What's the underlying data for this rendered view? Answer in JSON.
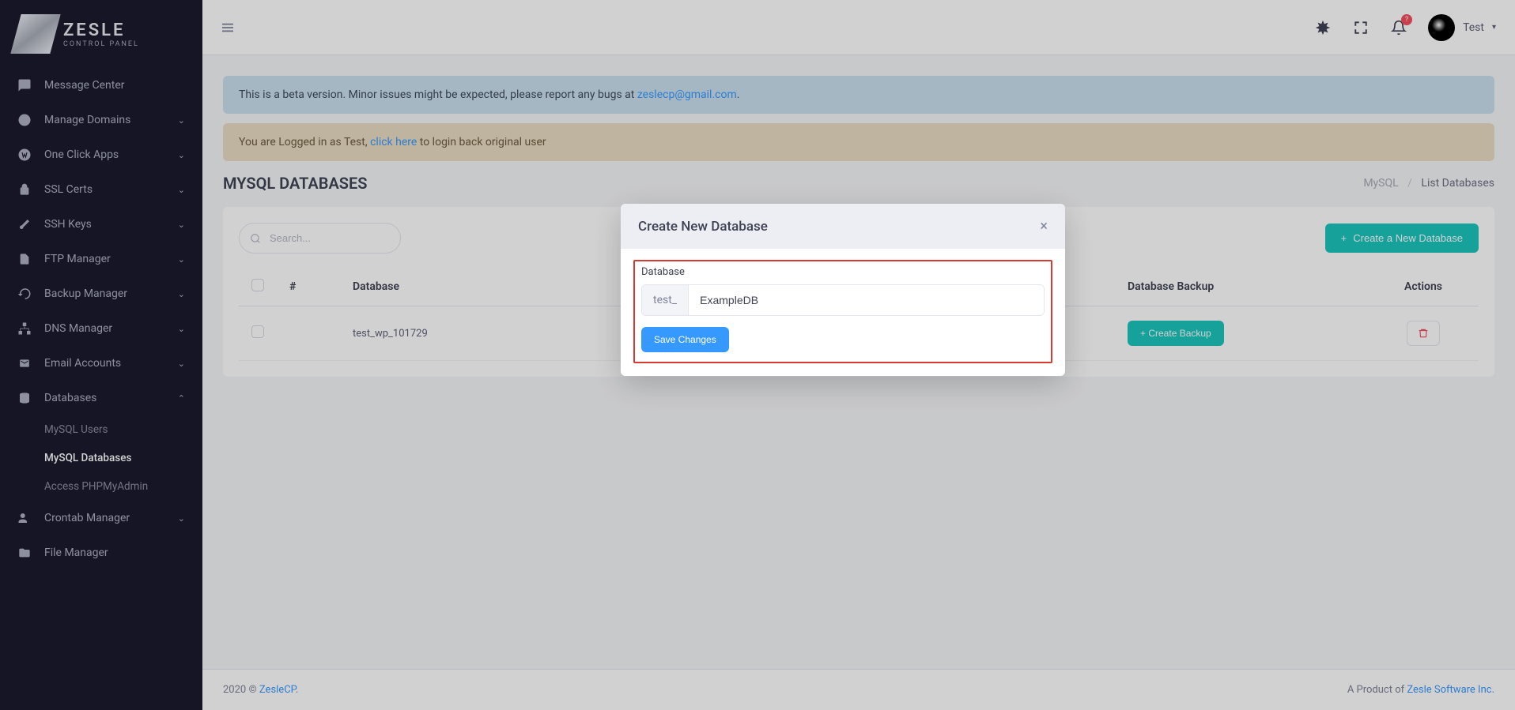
{
  "brand": {
    "name": "ZESLE",
    "tagline": "CONTROL PANEL"
  },
  "sidebar": {
    "items": [
      {
        "label": "Message Center",
        "icon": "message-icon",
        "expandable": false
      },
      {
        "label": "Manage Domains",
        "icon": "globe-icon",
        "expandable": true
      },
      {
        "label": "One Click Apps",
        "icon": "wordpress-icon",
        "expandable": true
      },
      {
        "label": "SSL Certs",
        "icon": "lock-icon",
        "expandable": true
      },
      {
        "label": "SSH Keys",
        "icon": "key-icon",
        "expandable": true
      },
      {
        "label": "FTP Manager",
        "icon": "file-icon",
        "expandable": true
      },
      {
        "label": "Backup Manager",
        "icon": "history-icon",
        "expandable": true
      },
      {
        "label": "DNS Manager",
        "icon": "sitemap-icon",
        "expandable": true
      },
      {
        "label": "Email Accounts",
        "icon": "mail-icon",
        "expandable": true
      },
      {
        "label": "Databases",
        "icon": "database-icon",
        "expandable": true,
        "expanded": true
      },
      {
        "label": "Crontab Manager",
        "icon": "users-icon",
        "expandable": true
      },
      {
        "label": "File Manager",
        "icon": "folder-icon",
        "expandable": false
      }
    ],
    "db_sub": [
      {
        "label": "MySQL Users",
        "active": false
      },
      {
        "label": "MySQL Databases",
        "active": true
      },
      {
        "label": "Access PHPMyAdmin",
        "active": false
      }
    ]
  },
  "topbar": {
    "notification_badge": "?",
    "user_name": "Test"
  },
  "alerts": {
    "beta_pre": "This is a beta version. Minor issues might be expected, please report any bugs at ",
    "beta_email": "zeslecp@gmail.com",
    "beta_post": ".",
    "login_pre": "You are Logged in as Test, ",
    "login_link": "click here",
    "login_post": " to login back original user"
  },
  "page": {
    "title": "MYSQL DATABASES",
    "crumb_root": "MySQL",
    "crumb_current": "List Databases",
    "search_placeholder": "Search...",
    "create_btn": "Create a New Database"
  },
  "table": {
    "cols": {
      "idx": "#",
      "db": "Database",
      "backup": "Database Backup",
      "actions": "Actions"
    },
    "rows": [
      {
        "db": "test_wp_101729",
        "backup_btn": "Create Backup"
      }
    ]
  },
  "modal": {
    "title": "Create New Database",
    "field_label": "Database",
    "prefix": "test_",
    "value": "ExampleDB",
    "save": "Save Changes"
  },
  "footer": {
    "left_pre": "2020 © ",
    "left_link": "ZesleCP",
    "left_post": ".",
    "right_pre": "A Product of ",
    "right_link": "Zesle Software Inc."
  }
}
